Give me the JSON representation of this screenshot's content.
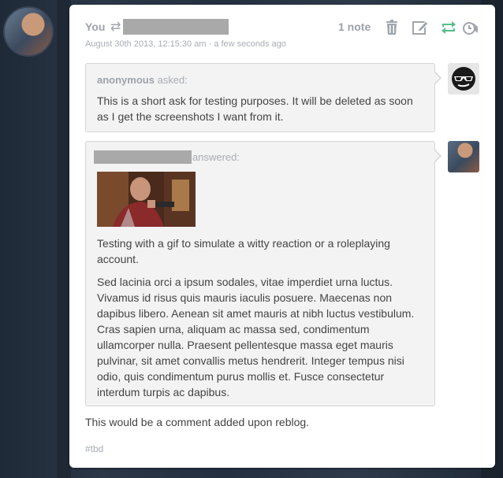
{
  "post": {
    "author": "You",
    "date": "August 30th 2013, 12:15:30 am",
    "relative_time": "a few seconds ago",
    "notes": "1 note"
  },
  "ask": {
    "asker": "anonymous",
    "asked_label": "asked:",
    "question": "This is a short ask for testing purposes. It will be deleted as soon as I get the screenshots I want from it."
  },
  "answer": {
    "answered_label": "answered:",
    "paragraph_1": "Testing with a gif to simulate a witty reaction or a roleplaying account.",
    "paragraph_2": "Sed lacinia orci a ipsum sodales, vitae imperdiet urna luctus. Vivamus id risus quis mauris iaculis posuere. Maecenas non dapibus libero. Aenean sit amet mauris at nibh luctus vestibulum. Cras sapien urna, aliquam ac massa sed, condimentum ullamcorper nulla. Praesent pellentesque massa eget mauris pulvinar, sit amet convallis metus hendrerit. Integer tempus nisi odio, quis condimentum purus mollis et. Fusce consectetur interdum turpis ac dapibus."
  },
  "reblog_comment": "This would be a comment added upon reblog.",
  "tags": [
    "#tbd"
  ],
  "icons": {
    "reblog_small": "reblog-icon",
    "delete": "trash-icon",
    "edit": "edit-icon",
    "reblog": "reblog-icon",
    "queue": "queue-icon"
  },
  "colors": {
    "reblog_green": "#56bc8a",
    "control_gray": "#a0a6ad",
    "card_bg": "#ffffff",
    "bubble_bg": "#f3f3f3"
  }
}
